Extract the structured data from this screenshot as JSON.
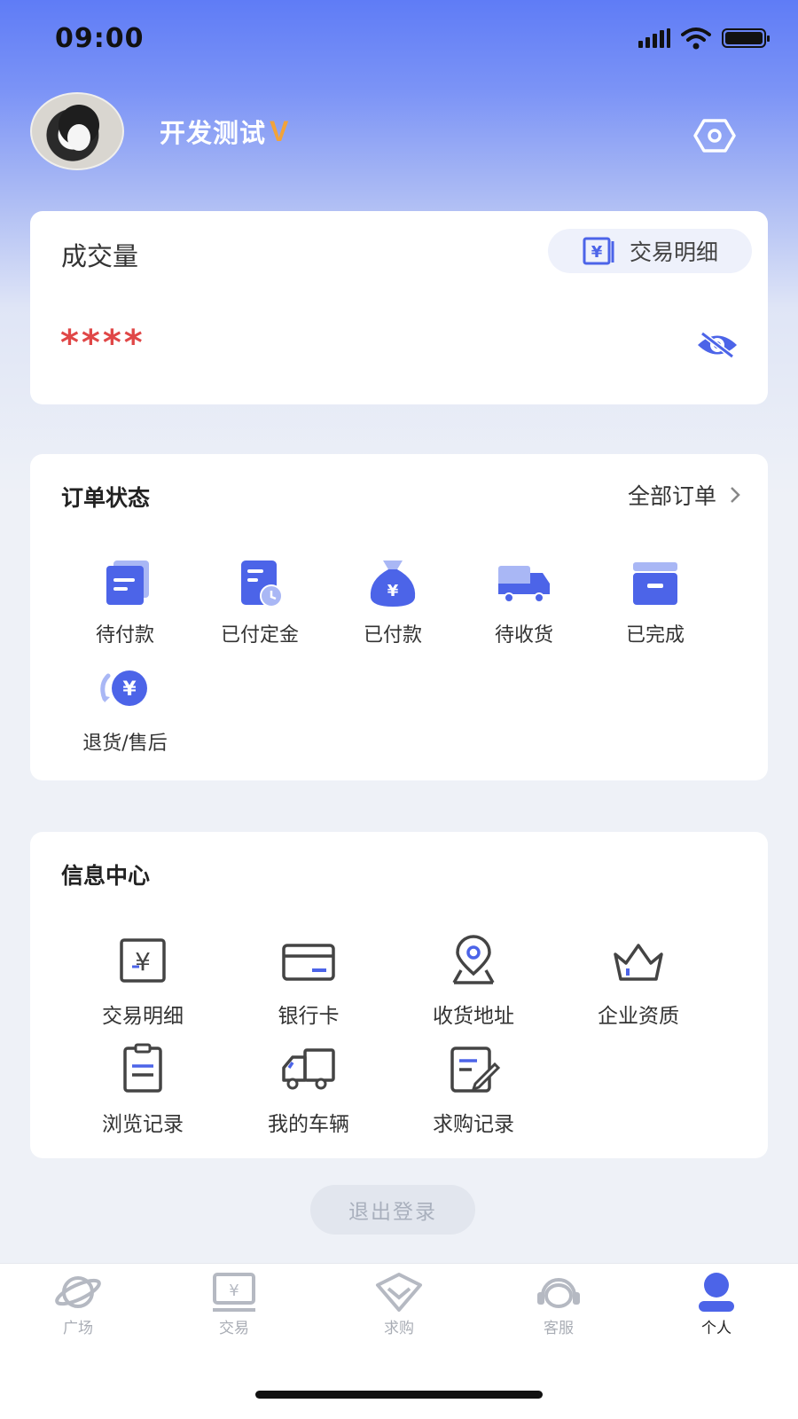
{
  "status_bar": {
    "time": "09:00"
  },
  "profile": {
    "username": "开发测试",
    "badge": "V"
  },
  "volume_card": {
    "title": "成交量",
    "detail_button_label": "交易明细",
    "masked_value": "****"
  },
  "orders": {
    "title": "订单状态",
    "all_label": "全部订单",
    "items": [
      {
        "label": "待付款",
        "icon": "pending-payment-icon"
      },
      {
        "label": "已付定金",
        "icon": "deposit-paid-icon"
      },
      {
        "label": "已付款",
        "icon": "money-bag-icon"
      },
      {
        "label": "待收货",
        "icon": "truck-icon"
      },
      {
        "label": "已完成",
        "icon": "box-icon"
      },
      {
        "label": "退货/售后",
        "icon": "refund-icon"
      }
    ]
  },
  "info_center": {
    "title": "信息中心",
    "items": [
      {
        "label": "交易明细",
        "icon": "yuan-receipt-icon"
      },
      {
        "label": "银行卡",
        "icon": "bank-card-icon"
      },
      {
        "label": "收货地址",
        "icon": "location-pin-icon"
      },
      {
        "label": "企业资质",
        "icon": "crown-icon"
      },
      {
        "label": "浏览记录",
        "icon": "clipboard-icon"
      },
      {
        "label": "我的车辆",
        "icon": "vehicle-icon"
      },
      {
        "label": "求购记录",
        "icon": "edit-note-icon"
      }
    ]
  },
  "logout_label": "退出登录",
  "tabbar": {
    "active": "个人",
    "tabs": [
      {
        "label": "广场",
        "icon": "planet-icon"
      },
      {
        "label": "交易",
        "icon": "trade-icon"
      },
      {
        "label": "求购",
        "icon": "diamond-icon"
      },
      {
        "label": "客服",
        "icon": "headset-icon"
      },
      {
        "label": "个人",
        "icon": "person-icon"
      }
    ]
  },
  "colors": {
    "accent": "#4c64e8",
    "masked_value": "#e04747",
    "vip_badge": "#f2a33a"
  }
}
